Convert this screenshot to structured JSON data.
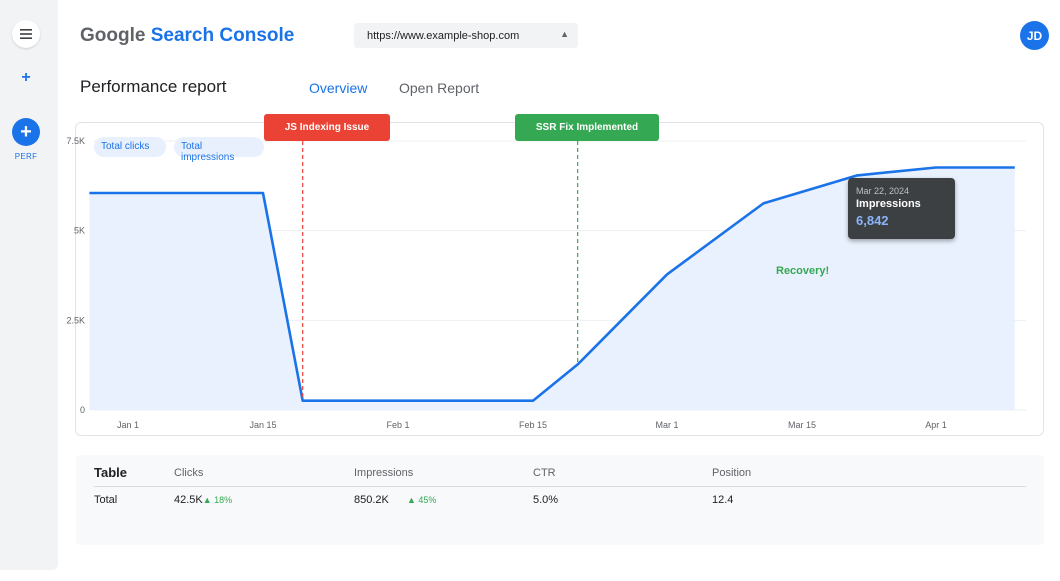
{
  "rail": {
    "menu_icon": "menu-icon",
    "add_icon": "plus-icon",
    "perf_label": "PERF"
  },
  "header": {
    "logo_google": "Google",
    "logo_product": "Search Console",
    "property_value": "https://www.example-shop.com",
    "avatar_initials": "JD"
  },
  "page": {
    "title": "Performance report",
    "tabs": [
      {
        "label": "Overview",
        "active": true
      },
      {
        "label": "Open Report",
        "active": false
      }
    ]
  },
  "chips": [
    "Total clicks",
    "Total impressions"
  ],
  "annotations": [
    {
      "label": "JS Indexing Issue",
      "color": "#ea4335"
    },
    {
      "label": "SSR Fix Implemented",
      "color": "#34a853"
    }
  ],
  "recovery_label": "Recovery!",
  "tooltip": {
    "date": "Mar 22, 2024",
    "metric": "Impressions",
    "value": "6,842"
  },
  "colors": {
    "accent": "#1a73e8",
    "area_fill": "#e8f0fe",
    "red": "#ea4335",
    "green": "#34a853"
  },
  "chart_data": {
    "type": "area",
    "x_ticks": [
      "Jan 1",
      "Jan 15",
      "Feb 1",
      "Feb 15",
      "Mar 1",
      "Mar 15",
      "Apr 1"
    ],
    "y_ticks": [
      "7.5K",
      "5K",
      "2.5K",
      "0"
    ],
    "ylim": [
      0,
      7500
    ],
    "grid": true,
    "series": [
      {
        "name": "Impressions",
        "x": [
          "Dec 28",
          "Jan 15",
          "Jan 20",
          "Feb 15",
          "Feb 20",
          "Mar 1",
          "Mar 11",
          "Mar 22",
          "Apr 1",
          "Apr 11"
        ],
        "values": [
          6050,
          6050,
          260,
          260,
          1270,
          3780,
          5760,
          6540,
          6760,
          6760
        ]
      }
    ],
    "events": [
      {
        "label": "JS Indexing Issue",
        "x": "Jan 20"
      },
      {
        "label": "SSR Fix Implemented",
        "x": "Feb 20"
      }
    ]
  },
  "table": {
    "heading": "Table",
    "columns": [
      "Clicks",
      "Impressions",
      "CTR",
      "Position"
    ],
    "row": {
      "label": "Total",
      "clicks": "42.5K",
      "clicks_delta": "▲ 18%",
      "impressions": "850.2K",
      "impressions_delta": "▲ 45%",
      "ctr": "5.0%",
      "position": "12.4"
    }
  }
}
